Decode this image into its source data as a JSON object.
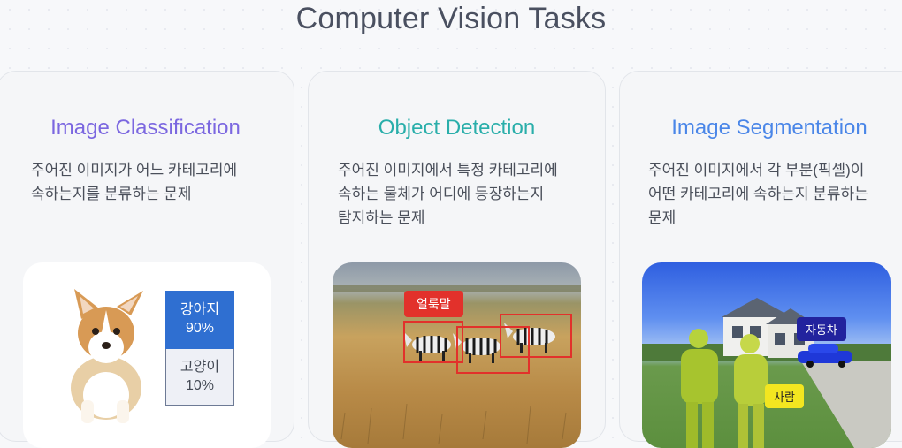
{
  "page": {
    "title": "Computer Vision Tasks"
  },
  "cards": [
    {
      "title": "Image Classification",
      "title_color": "#7b67e0",
      "description_lines": [
        "주어진 이미지가 어느 카테고리에",
        "속하는지를 분류하는 문제"
      ],
      "predictions": [
        {
          "label": "강아지",
          "value": "90%",
          "color": "#2f6fd1"
        },
        {
          "label": "고양이",
          "value": "10%",
          "color": "#eef0f6"
        }
      ]
    },
    {
      "title": "Object Detection",
      "title_color": "#29aeaa",
      "description_lines": [
        "주어진 이미지에서 특정 카테고리에",
        "속하는 물체가 어디에 등장하는지",
        "탐지하는 문제"
      ],
      "detection_label": "얼룩말",
      "box_color": "#e2312b"
    },
    {
      "title": "Image Segmentation",
      "title_color": "#4a86e8",
      "description_lines": [
        "주어진 이미지에서 각 부분(픽셀)이",
        "어떤 카테고리에 속하는지 분류하는",
        "문제"
      ],
      "labels": {
        "car": "자동차",
        "person": "사람"
      }
    }
  ]
}
